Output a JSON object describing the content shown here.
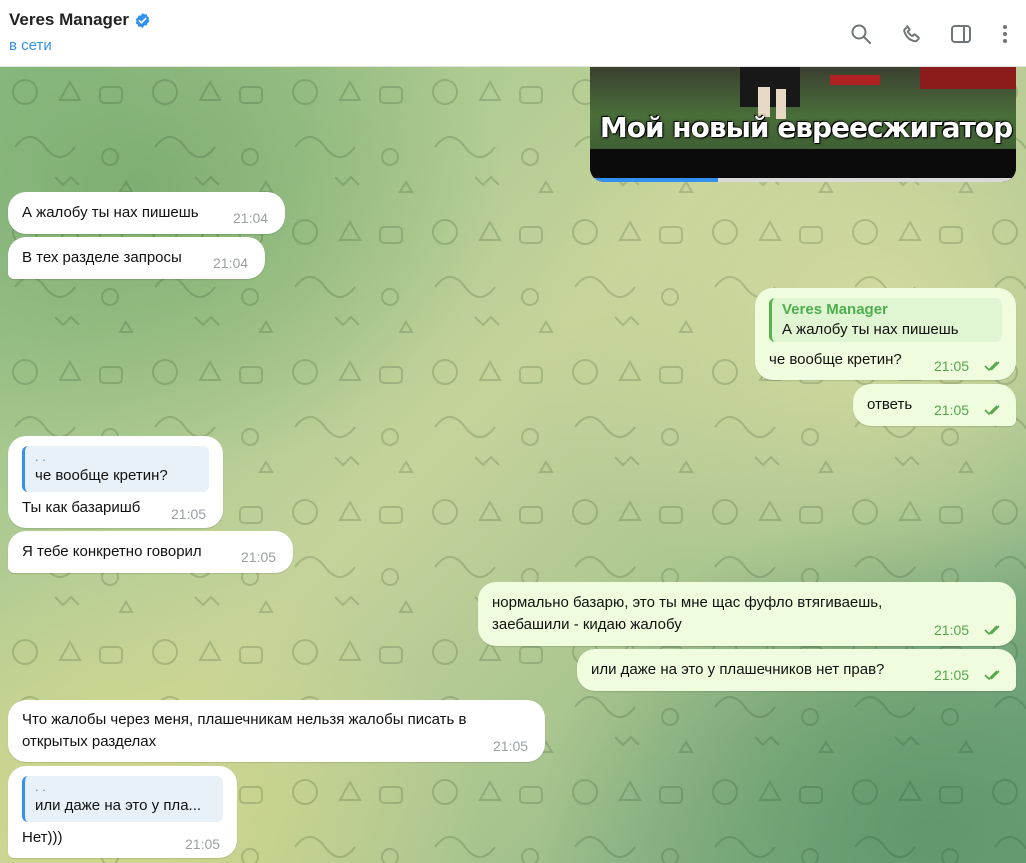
{
  "header": {
    "name": "Veres Manager",
    "status": "в сети"
  },
  "video": {
    "caption": "Мой новый евреесжигатор",
    "progress": 0.3
  },
  "messages": [
    {
      "text": "А жалобу ты нах пишешь",
      "time": "21:04"
    },
    {
      "text": "В тех разделе запросы",
      "time": "21:04"
    },
    {
      "reply_name": "Veres Manager",
      "reply_text": "А жалобу ты нах пишешь",
      "text": "че вообще кретин?",
      "time": "21:05"
    },
    {
      "text": "ответь",
      "time": "21:05"
    },
    {
      "reply_name": ". .",
      "reply_text": "че вообще кретин?",
      "text": "Ты как базаришб",
      "time": "21:05"
    },
    {
      "text": "Я тебе конкретно говорил",
      "time": "21:05"
    },
    {
      "text_line1": "нормально базарю, это ты мне щас фуфло втягиваешь,",
      "text_line2": "заебашили - кидаю жалобу",
      "time": "21:05"
    },
    {
      "text": "или даже на это у плашечников нет прав?",
      "time": "21:05"
    },
    {
      "text_line1": "Что жалобы через меня, плашечникам нельзя жалобы писать в",
      "text_line2": "открытых разделах",
      "time": "21:05"
    },
    {
      "reply_name": ". .",
      "reply_text": "или даже на это у пла...",
      "text": "Нет)))",
      "time": "21:05"
    }
  ]
}
